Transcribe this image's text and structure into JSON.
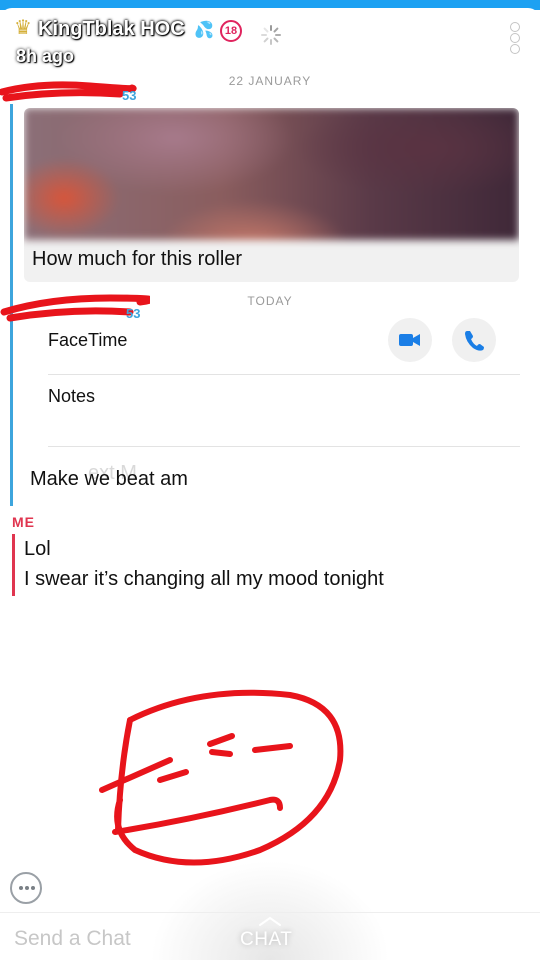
{
  "header": {
    "sender_name": "KingTblak HOC",
    "age_badge": "18",
    "time_ago": "8h ago"
  },
  "thread": {
    "date_separator_1": "22 JANUARY",
    "date_separator_2": "TODAY",
    "friend_label_1_suffix": "53",
    "friend_label_2_suffix": "53",
    "media_caption": "How much for this roller",
    "contact_card": {
      "row1": "FaceTime",
      "row2": "Notes"
    },
    "ghost_text": "ext M",
    "friend_message": "Make we beat am",
    "me_label": "ME",
    "my_messages": [
      "Lol",
      "I swear it’s changing all my mood tonight"
    ]
  },
  "composer": {
    "placeholder": "Send a Chat",
    "chat_tab": "CHAT"
  },
  "colors": {
    "friend_accent": "#3da5dd",
    "me_accent": "#e0354f",
    "annotation_red": "#e8141b",
    "call_icon_blue": "#1a7ee6"
  },
  "icons": {
    "crown": "crown-icon",
    "drip": "water-drop-icon",
    "spinner": "loading-spinner-icon",
    "menu": "vertical-dots-icon",
    "video": "video-camera-icon",
    "phone": "phone-icon",
    "emoji": "chat-bubble-icon",
    "chevron": "chevron-up-icon"
  }
}
